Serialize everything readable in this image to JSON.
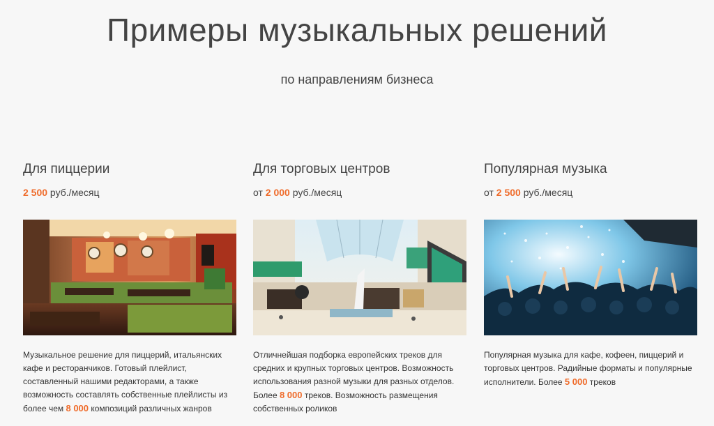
{
  "header": {
    "title": "Примеры музыкальных решений",
    "subtitle": "по направлениям бизнеса"
  },
  "cards": [
    {
      "title": "Для пиццерии",
      "price_prefix": "",
      "price_amount": "2 500",
      "price_suffix": " руб./месяц",
      "desc_before": "Музыкальное решение для пиццерий, итальянских кафе и ресторанчиков. Готовый плейлист, составленный нашими редакторами, а также возможность составлять собственные плейлисты из более чем ",
      "desc_highlight": "8 000",
      "desc_after": " композиций различных жанров",
      "image": "pizzeria-interior"
    },
    {
      "title": "Для торговых центров",
      "price_prefix": "от ",
      "price_amount": "2 000",
      "price_suffix": " руб./месяц",
      "desc_before": "Отличнейшая подборка европейских треков для средних и крупных торговых центров. Возможность использования разной музыки для разных отделов. Более ",
      "desc_highlight": "8 000",
      "desc_after": " треков. Возможность размещения собственных роликов",
      "image": "shopping-mall-atrium"
    },
    {
      "title": "Популярная музыка",
      "price_prefix": "от ",
      "price_amount": "2 500",
      "price_suffix": " руб./месяц",
      "desc_before": "Популярная музыка для кафе, кофеен, пиццерий и торговых центров. Радийные форматы и популярные исполнители. Более ",
      "desc_highlight": "5 000",
      "desc_after": " треков",
      "image": "concert-crowd"
    }
  ],
  "colors": {
    "accent": "#ef6b2a",
    "text": "#333333",
    "background": "#f7f7f7"
  }
}
